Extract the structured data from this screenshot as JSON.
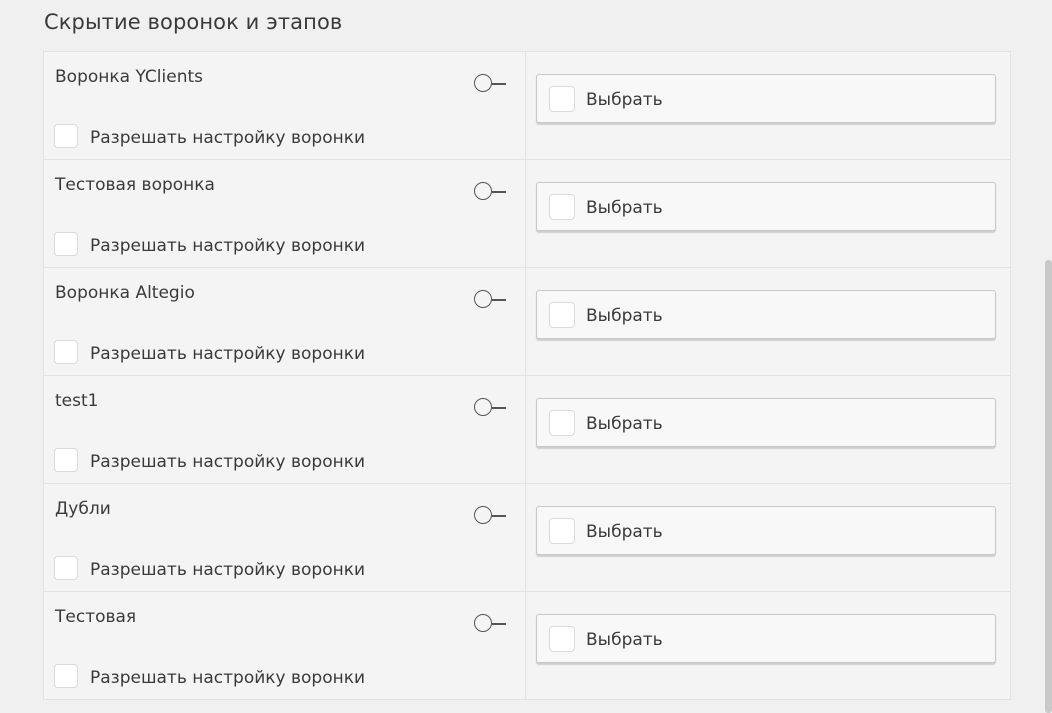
{
  "section": {
    "title": "Скрытие воронок и этапов"
  },
  "funnels": [
    {
      "name": "Воронка YClients",
      "allow_label": "Разрешать настройку воронки",
      "select_label": "Выбрать"
    },
    {
      "name": "Тестовая воронка",
      "allow_label": "Разрешать настройку воронки",
      "select_label": "Выбрать"
    },
    {
      "name": "Воронка Altegio",
      "allow_label": "Разрешать настройку воронки",
      "select_label": "Выбрать"
    },
    {
      "name": "test1",
      "allow_label": "Разрешать настройку воронки",
      "select_label": "Выбрать"
    },
    {
      "name": "Дубли",
      "allow_label": "Разрешать настройку воронки",
      "select_label": "Выбрать"
    },
    {
      "name": "Тестовая",
      "allow_label": "Разрешать настройку воронки",
      "select_label": "Выбрать"
    }
  ],
  "icons": {
    "toggle": "toggle-off-icon"
  },
  "colors": {
    "background": "#f0f0f0",
    "row_background": "#f4f4f4",
    "text": "#3a3a3a"
  }
}
